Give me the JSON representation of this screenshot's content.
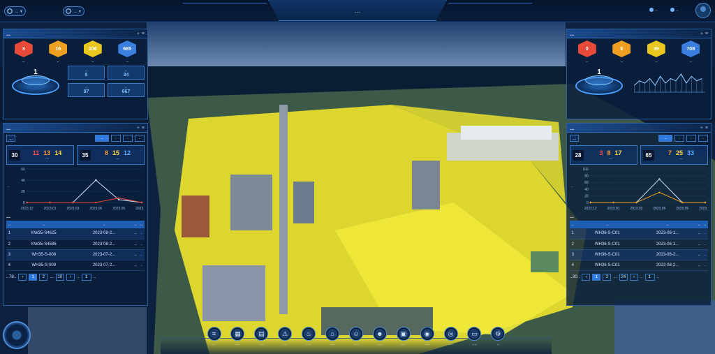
{
  "topbar": {
    "select1": "..",
    "select2": "..",
    "title": "...",
    "right1": "..",
    "right2": ".."
  },
  "colors": {
    "red": "#e84a3a",
    "orange": "#f0a020",
    "yellow": "#e8c820",
    "blue": "#3a7ee0",
    "accent": "#2f7ae0",
    "highlight": "#f2ea3a"
  },
  "left_top": {
    "title": "...",
    "cubes": [
      {
        "value": "3",
        "label": "..",
        "color": "#e84a3a"
      },
      {
        "value": "16",
        "label": "..",
        "color": "#f0a020"
      },
      {
        "value": "106",
        "label": "..",
        "color": "#e8c820"
      },
      {
        "value": "685",
        "label": "..",
        "color": "#3a7ee0"
      }
    ],
    "podium_value": "1",
    "levels": [
      {
        "label": "..",
        "value": "8"
      },
      {
        "label": "..",
        "value": "34"
      },
      {
        "label": "..",
        "value": "97"
      },
      {
        "label": "..",
        "value": "667"
      }
    ]
  },
  "left_warn": {
    "title": "...",
    "filter_label": "...",
    "period_tabs": [
      "..",
      ".",
      ".",
      "."
    ],
    "stat1": {
      "total": "30",
      "a": "11",
      "b": "13",
      "c": "14",
      "caption": "..."
    },
    "stat2": {
      "total": "35",
      "a": "8",
      "b": "15",
      "c": "12",
      "caption": "..."
    },
    "chart_data": {
      "type": "line",
      "x": [
        "2023.12",
        "2023.01",
        "2023.03",
        "2023.06",
        "2023.05",
        "2023.10"
      ],
      "ylim": [
        0,
        60
      ],
      "yticks": [
        "60",
        "40",
        "20",
        "0"
      ],
      "ylabel": "..",
      "series": [
        {
          "values": [
            0,
            0,
            0,
            40,
            5,
            0
          ],
          "color": "#cfe6ff"
        },
        {
          "values": [
            0,
            0,
            0,
            0,
            8,
            0
          ],
          "color": "#e84a3a"
        }
      ]
    },
    "table_title": "...",
    "table": {
      "headers": [
        "..",
        "..",
        "..",
        "..",
        ".."
      ],
      "rows": [
        [
          "1",
          "KW35-S4625",
          "2023-08-2...",
          "..",
          ".."
        ],
        [
          "2",
          "KW35-S4586",
          "2023-08-2...",
          "..",
          ".."
        ],
        [
          "3",
          "WH35-S-008",
          "2023-07-2...",
          "..",
          ".."
        ],
        [
          "4",
          "WH35-S-009",
          "2023-07-2...",
          "..",
          ".."
        ]
      ]
    },
    "pager": {
      "total": "..78..",
      "pages": [
        "1",
        "2",
        "...",
        "10"
      ],
      "goto": "..",
      "current": "1",
      "unit": ".."
    }
  },
  "right_top": {
    "title": "...",
    "cubes": [
      {
        "value": "0",
        "label": "..",
        "color": "#e84a3a"
      },
      {
        "value": "9",
        "label": "..",
        "color": "#f0a020"
      },
      {
        "value": "39",
        "label": "..",
        "color": "#e8c820"
      },
      {
        "value": "708",
        "label": "..",
        "color": "#3a7ee0"
      }
    ],
    "podium_value": "1",
    "spark_values": [
      3,
      5,
      4,
      6,
      3,
      7,
      4,
      6,
      5,
      8,
      4,
      7,
      5,
      6
    ]
  },
  "right_warn": {
    "title": "...",
    "filter_label": "...",
    "period_tabs": [
      "..",
      ".",
      ".",
      "."
    ],
    "stat1": {
      "total": "28",
      "a": "3",
      "b": "8",
      "c": "17",
      "caption": "..."
    },
    "stat2": {
      "total": "65",
      "a": "7",
      "b": "25",
      "c": "33",
      "caption": "..."
    },
    "chart_data": {
      "type": "line",
      "x": [
        "2022.12",
        "2023.01",
        "2023.03",
        "2023.06",
        "2023.05",
        "2023.10"
      ],
      "ylim": [
        0,
        100
      ],
      "yticks": [
        "100",
        "80",
        "60",
        "40",
        "20",
        "0"
      ],
      "ylabel": "..",
      "series": [
        {
          "values": [
            0,
            0,
            0,
            70,
            0,
            0
          ],
          "color": "#cfe6ff"
        },
        {
          "values": [
            0,
            0,
            0,
            30,
            0,
            0
          ],
          "color": "#f0a020"
        }
      ]
    },
    "table_title": "...",
    "table": {
      "headers": [
        "..",
        "..",
        "..",
        "..",
        ".."
      ],
      "rows": [
        [
          "1",
          "WH36-S-C01",
          "2023-08-1...",
          "..",
          ".."
        ],
        [
          "2",
          "WH36-S-C01",
          "2023-08-1...",
          "..",
          ".."
        ],
        [
          "3",
          "WH36-S-C01",
          "2023-08-2...",
          "..",
          ".."
        ],
        [
          "4",
          "WH36-S-C01",
          "2023-08-2...",
          "..",
          ".."
        ]
      ]
    },
    "pager": {
      "total": "..30..",
      "pages": [
        "1",
        "2",
        "...",
        "24"
      ],
      "goto": "..",
      "current": "1",
      "unit": ".."
    }
  },
  "dock": [
    {
      "label": "...",
      "icon": "home-icon",
      "glyph": "≡"
    },
    {
      "label": "....",
      "icon": "grid-icon",
      "glyph": "▦"
    },
    {
      "label": "....",
      "icon": "chart-icon",
      "glyph": "▤"
    },
    {
      "label": "...",
      "icon": "warning-icon",
      "glyph": "⚠"
    },
    {
      "label": "....",
      "icon": "fire-icon",
      "glyph": "♨"
    },
    {
      "label": "....",
      "icon": "building-icon",
      "glyph": "⌂"
    },
    {
      "label": "....",
      "icon": "person-icon",
      "glyph": "☺"
    },
    {
      "label": "....",
      "icon": "user-icon",
      "glyph": "☻"
    },
    {
      "label": "....",
      "icon": "document-icon",
      "glyph": "▣"
    },
    {
      "label": "....",
      "icon": "camera-icon",
      "glyph": "◉"
    },
    {
      "label": "....",
      "icon": "target-icon",
      "glyph": "◎"
    },
    {
      "label": "....",
      "icon": "monitor-icon",
      "glyph": "▭"
    },
    {
      "label": "..",
      "icon": "tool-icon",
      "glyph": "⚙"
    }
  ]
}
